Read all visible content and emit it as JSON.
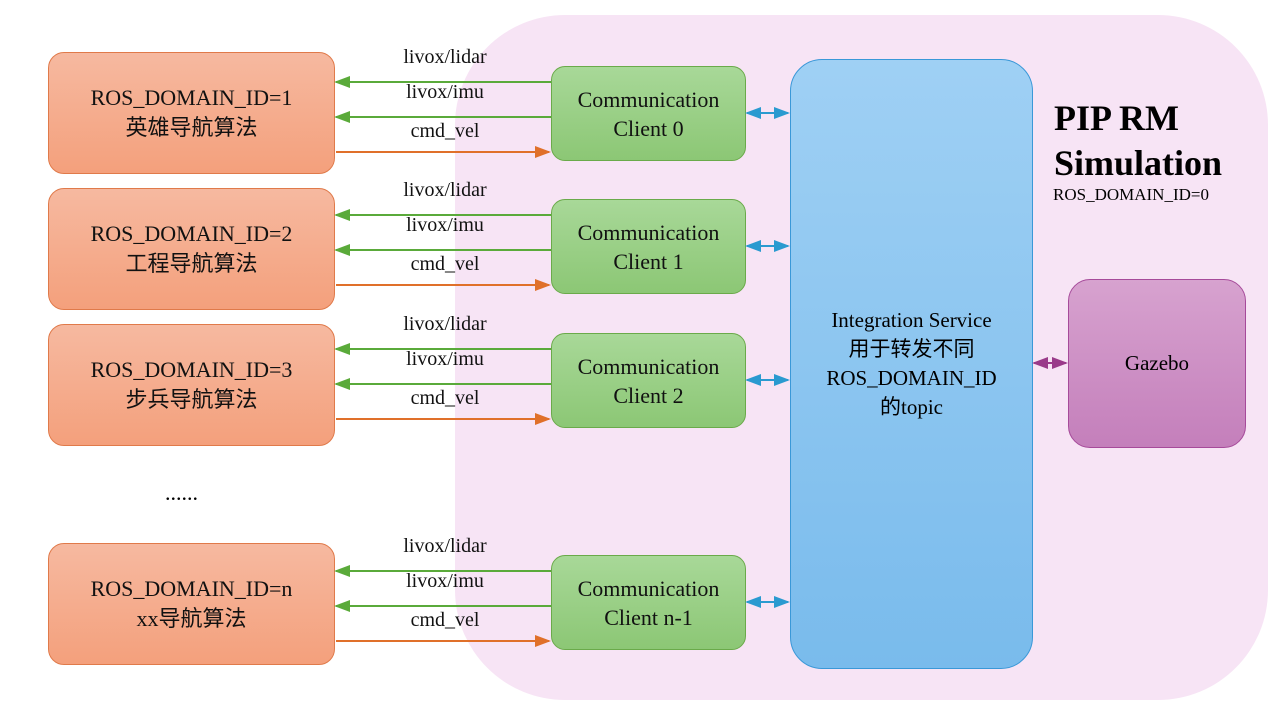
{
  "title": {
    "line1": "PIP RM",
    "line2": "Simulation",
    "domain": "ROS_DOMAIN_ID=0"
  },
  "integration": {
    "line1": "Integration Service",
    "line2": "用于转发不同",
    "line3": "ROS_DOMAIN_ID",
    "line4": "的topic"
  },
  "gazebo": "Gazebo",
  "ellipsis": "......",
  "topics": [
    "livox/lidar",
    "livox/imu",
    "cmd_vel"
  ],
  "rows": [
    {
      "domain": "ROS_DOMAIN_ID=1",
      "algo": "英雄导航算法",
      "client1": "Communication",
      "client2": "Client 0"
    },
    {
      "domain": "ROS_DOMAIN_ID=2",
      "algo": "工程导航算法",
      "client1": "Communication",
      "client2": "Client 1"
    },
    {
      "domain": "ROS_DOMAIN_ID=3",
      "algo": "步兵导航算法",
      "client1": "Communication",
      "client2": "Client 2"
    },
    {
      "domain": "ROS_DOMAIN_ID=n",
      "algo": "xx导航算法",
      "client1": "Communication",
      "client2": "Client n-1"
    }
  ],
  "colors": {
    "green_arrow": "#5aaa3a",
    "orange_arrow": "#e0702a",
    "blue_arrow": "#2a9ad0",
    "purple_arrow": "#9a3a8a"
  }
}
